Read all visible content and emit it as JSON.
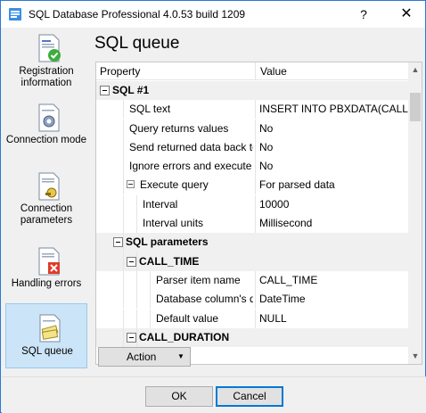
{
  "window": {
    "title": "SQL Database Professional 4.0.53 build 1209",
    "help_glyph": "?",
    "close_glyph": "✕"
  },
  "sidebar": {
    "items": [
      {
        "label": "Registration information",
        "icon": "registration-icon"
      },
      {
        "label": "Connection mode",
        "icon": "connection-mode-icon"
      },
      {
        "label": "Connection parameters",
        "icon": "connection-parameters-icon"
      },
      {
        "label": "Handling errors",
        "icon": "handling-errors-icon"
      },
      {
        "label": "SQL queue",
        "icon": "sql-queue-icon",
        "active": true
      }
    ]
  },
  "main": {
    "title": "SQL queue",
    "grid": {
      "columns": [
        "Property",
        "Value"
      ],
      "rows": [
        {
          "type": "category",
          "property": "SQL #1",
          "value": "",
          "level": 0
        },
        {
          "type": "item",
          "property": "SQL text",
          "value": "INSERT INTO PBXDATA(CALL...",
          "level": 1
        },
        {
          "type": "item",
          "property": "Query returns values",
          "value": "No",
          "level": 1
        },
        {
          "type": "item",
          "property": "Send returned data back to dat...",
          "value": "No",
          "level": 1
        },
        {
          "type": "item",
          "property": "Ignore errors and execute next",
          "value": "No",
          "level": 1
        },
        {
          "type": "expander",
          "property": "Execute query",
          "value": "For parsed data",
          "level": 1
        },
        {
          "type": "item",
          "property": "Interval",
          "value": "10000",
          "level": 2
        },
        {
          "type": "item",
          "property": "Interval units",
          "value": "Millisecond",
          "level": 2
        },
        {
          "type": "category",
          "property": "SQL parameters",
          "value": "",
          "level": 1
        },
        {
          "type": "category",
          "property": "CALL_TIME",
          "value": "",
          "level": 2
        },
        {
          "type": "item",
          "property": "Parser item name",
          "value": "CALL_TIME",
          "level": 3
        },
        {
          "type": "item",
          "property": "Database column's data...",
          "value": "DateTime",
          "level": 3
        },
        {
          "type": "item",
          "property": "Default value",
          "value": "NULL",
          "level": 3
        },
        {
          "type": "category",
          "property": "CALL_DURATION",
          "value": "",
          "level": 2
        }
      ]
    },
    "action_button": "Action"
  },
  "footer": {
    "ok": "OK",
    "cancel": "Cancel"
  },
  "colors": {
    "window_border": "#2b79d6",
    "active_item_bg": "#cce4f7",
    "active_item_border": "#99c9ef",
    "default_button_border": "#0078d7"
  }
}
